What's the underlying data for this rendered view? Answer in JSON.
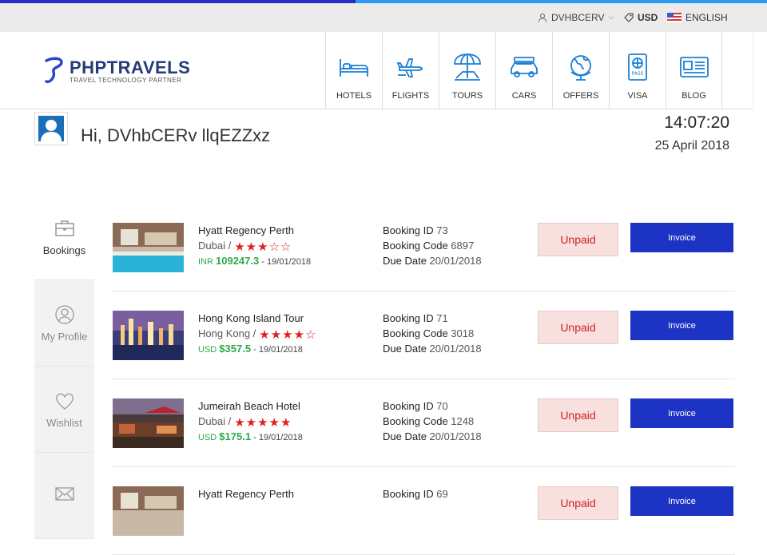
{
  "topbar": {
    "user_label": "DVHBCERV",
    "currency": "USD",
    "language": "ENGLISH"
  },
  "brand": {
    "name": "PHPTRAVELS",
    "tagline": "TRAVEL TECHNOLOGY PARTNER"
  },
  "nav": [
    {
      "label": "HOTELS",
      "icon": "bed-icon"
    },
    {
      "label": "FLIGHTS",
      "icon": "plane-icon"
    },
    {
      "label": "TOURS",
      "icon": "umbrella-icon"
    },
    {
      "label": "CARS",
      "icon": "car-icon"
    },
    {
      "label": "OFFERS",
      "icon": "globe-icon"
    },
    {
      "label": "VISA",
      "icon": "passport-icon"
    },
    {
      "label": "BLOG",
      "icon": "id-card-icon"
    }
  ],
  "header": {
    "greeting": "Hi, DVhbCERv llqEZZxz",
    "time": "14:07:20",
    "date": "25 April 2018"
  },
  "sidebar": [
    {
      "label": "Bookings",
      "icon": "briefcase-icon",
      "active": true
    },
    {
      "label": "My Profile",
      "icon": "user-circle-icon",
      "active": false
    },
    {
      "label": "Wishlist",
      "icon": "heart-icon",
      "active": false
    },
    {
      "label": "",
      "icon": "envelope-icon",
      "active": false
    }
  ],
  "labels": {
    "booking_id": "Booking ID",
    "booking_code": "Booking Code",
    "due_date": "Due Date",
    "invoice": "Invoice"
  },
  "bookings": [
    {
      "name": "Hyatt Regency Perth",
      "location": "Dubai /",
      "stars": "★★★☆☆",
      "currency": "INR",
      "price": "109247.3",
      "date": "- 19/01/2018",
      "id": "73",
      "code": "6897",
      "due": "20/01/2018",
      "status": "Unpaid"
    },
    {
      "name": "Hong Kong Island Tour",
      "location": "Hong Kong /",
      "stars": "★★★★☆",
      "currency": "USD",
      "price": "$357.5",
      "date": "- 19/01/2018",
      "id": "71",
      "code": "3018",
      "due": "20/01/2018",
      "status": "Unpaid"
    },
    {
      "name": "Jumeirah Beach Hotel",
      "location": "Dubai /",
      "stars": "★★★★★",
      "currency": "USD",
      "price": "$175.1",
      "date": "- 19/01/2018",
      "id": "70",
      "code": "1248",
      "due": "20/01/2018",
      "status": "Unpaid"
    },
    {
      "name": "Hyatt Regency Perth",
      "location": "",
      "stars": "",
      "currency": "",
      "price": "",
      "date": "",
      "id": "69",
      "code": "",
      "due": "",
      "status": "Unpaid"
    }
  ],
  "colors": {
    "accent": "#1c33c4",
    "price_green": "#2ea94a",
    "star_red": "#e02020",
    "unpaid_bg": "#f8e0df"
  }
}
